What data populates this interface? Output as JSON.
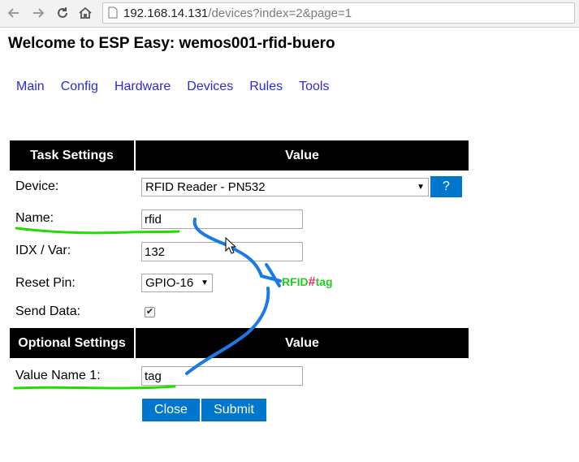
{
  "browser": {
    "url_host": "192.168.14.131",
    "url_path": "/devices?index=2&page=1"
  },
  "page": {
    "title": "Welcome to ESP Easy: wemos001-rfid-buero"
  },
  "menu": {
    "items": [
      "Main",
      "Config",
      "Hardware",
      "Devices",
      "Rules",
      "Tools"
    ]
  },
  "task_table": {
    "header_left": "Task Settings",
    "header_right": "Value",
    "device_label": "Device:",
    "device_value": "RFID Reader - PN532",
    "help_label": "?",
    "name_label": "Name:",
    "name_value": "rfid",
    "idx_label": "IDX / Var:",
    "idx_value": "132",
    "reset_label": "Reset Pin:",
    "reset_value": "GPIO-16",
    "send_label": "Send Data:",
    "send_checked": true
  },
  "optional_table": {
    "header_left": "Optional Settings",
    "header_right": "Value",
    "valuename_label": "Value Name 1:",
    "valuename_value": "tag"
  },
  "buttons": {
    "close": "Close",
    "submit": "Submit"
  },
  "annotation": {
    "part1": "RFID",
    "separator": "#",
    "part2": "tag",
    "color_part1": "#22cc22",
    "color_separator": "#ff2266",
    "color_part2": "#22cc22",
    "underline_color": "#22dd00",
    "arrow_color": "#1a7ae8"
  }
}
